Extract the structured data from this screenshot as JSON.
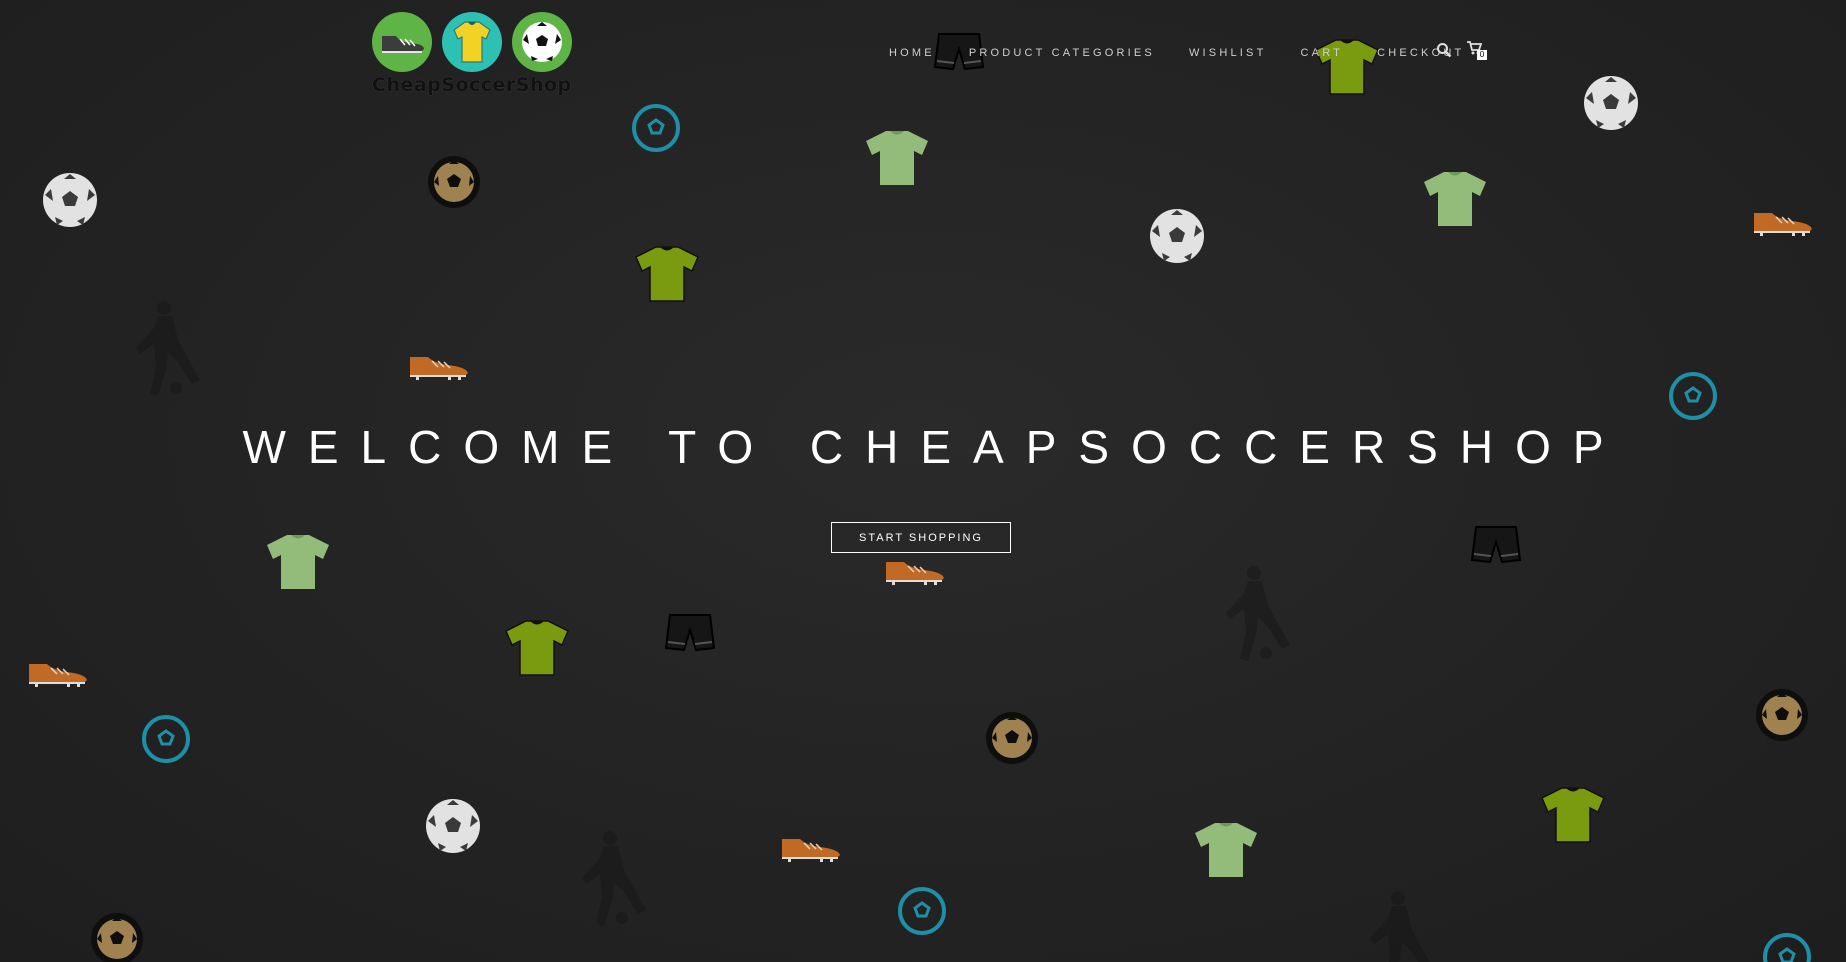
{
  "logo": {
    "wordmark": "CheapSoccerShop",
    "icons": [
      "boot-icon",
      "jersey-icon",
      "soccer-ball-icon"
    ],
    "colors": {
      "left": "#5fb446",
      "middle": "#2fc0b4",
      "right": "#5fb446",
      "jersey": "#f2d224"
    }
  },
  "nav": {
    "items": [
      "HOME",
      "PRODUCT CATEGORIES",
      "WISHLIST",
      "CART",
      "CHECKOUT"
    ],
    "search_icon": "search-icon",
    "cart_icon": "shopping-cart-icon",
    "cart_count": "0"
  },
  "hero": {
    "title": "WELCOME TO CHEAPSOCCERSHOP",
    "cta_label": "START SHOPPING"
  },
  "background": {
    "decor_icons": [
      "soccer-ball-icon",
      "jersey-icon",
      "boot-icon",
      "shorts-icon",
      "player-silhouette-icon"
    ],
    "colors": {
      "page": "#232323",
      "jersey_light": "#93bb7a",
      "jersey_dark": "#7a9a0f",
      "boot": "#c06a26",
      "ball_blue": "#1e8fa6",
      "ball_gold": "#a08250",
      "ball_grey": "#d8d8d8"
    }
  }
}
